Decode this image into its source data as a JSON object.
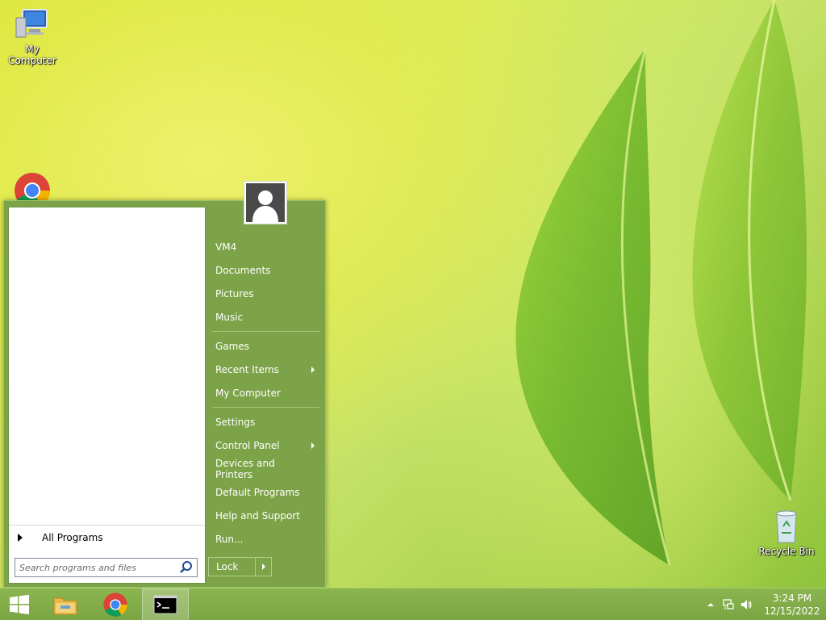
{
  "desktop": {
    "icons": [
      {
        "name": "my-computer",
        "label": "My Computer"
      },
      {
        "name": "chrome",
        "label": ""
      },
      {
        "name": "recycle-bin",
        "label": "Recycle Bin"
      }
    ]
  },
  "start_menu": {
    "all_programs_label": "All Programs",
    "search_placeholder": "Search programs and files",
    "right_pane": {
      "group1": [
        "VM4",
        "Documents",
        "Pictures",
        "Music"
      ],
      "group2": [
        "Games",
        "Recent Items",
        "My Computer"
      ],
      "group3": [
        "Settings",
        "Control Panel",
        "Devices and Printers",
        "Default Programs",
        "Help and Support",
        "Run..."
      ]
    },
    "lock_label": "Lock"
  },
  "taskbar": {
    "clock_time": "3:24 PM",
    "clock_date": "12/15/2022"
  },
  "colors": {
    "start_menu_bg": "#7da348",
    "taskbar_bg": "#7aa542"
  }
}
